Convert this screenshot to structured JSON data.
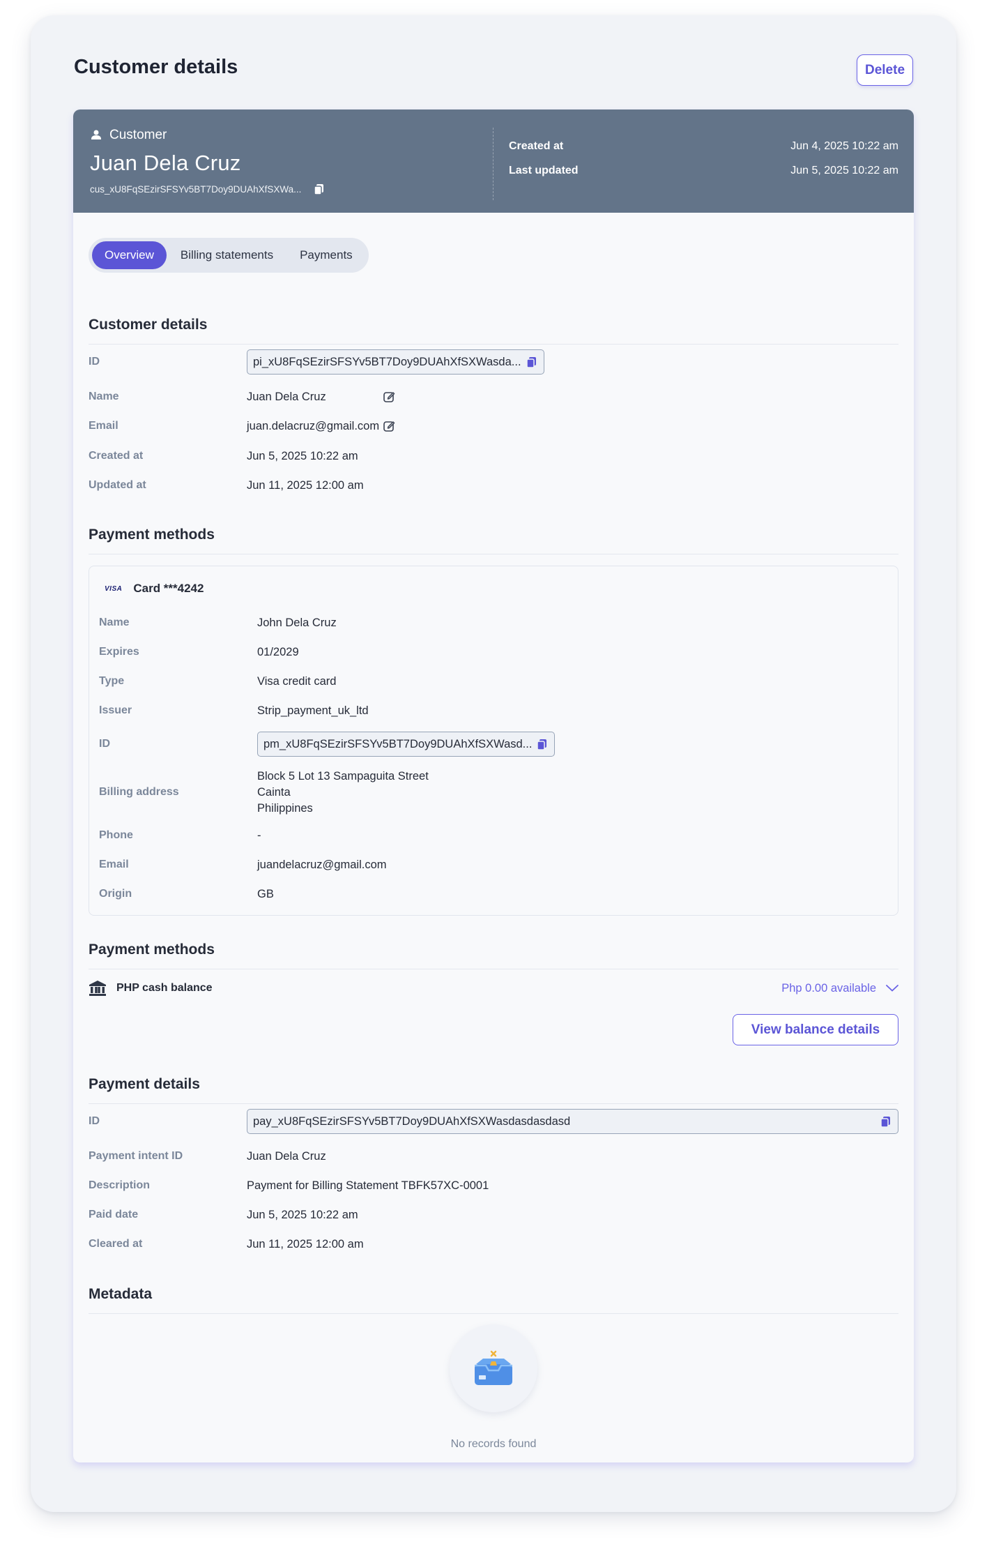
{
  "page": {
    "title": "Customer details",
    "delete_label": "Delete"
  },
  "hero": {
    "kind_label": "Customer",
    "name": "Juan Dela Cruz",
    "customer_id": "cus_xU8FqSEzirSFSYv5BT7Doy9DUAhXfSXWa...",
    "meta": [
      {
        "label": "Created at",
        "value": "Jun 4, 2025 10:22 am"
      },
      {
        "label": "Last updated",
        "value": "Jun 5, 2025 10:22 am"
      }
    ]
  },
  "tabs": [
    "Overview",
    "Billing statements",
    "Payments"
  ],
  "customer_details": {
    "title": "Customer details",
    "id_label": "ID",
    "id_value": "pi_xU8FqSEzirSFSYv5BT7Doy9DUAhXfSXWasda...",
    "name_label": "Name",
    "name_value": "Juan Dela Cruz",
    "email_label": "Email",
    "email_value": "juan.delacruz@gmail.com",
    "created_label": "Created at",
    "created_value": "Jun 5, 2025 10:22 am",
    "updated_label": "Updated at",
    "updated_value": "Jun 11, 2025 12:00 am"
  },
  "payment_methods": {
    "title": "Payment methods",
    "card_brand": "VISA",
    "card_label": "Card ***4242",
    "name_label": "Name",
    "name_value": "John Dela Cruz",
    "expires_label": "Expires",
    "expires_value": "01/2029",
    "type_label": "Type",
    "type_value": "Visa credit card",
    "issuer_label": "Issuer",
    "issuer_value": "Strip_payment_uk_ltd",
    "id_label": "ID",
    "id_value": "pm_xU8FqSEzirSFSYv5BT7Doy9DUAhXfSXWasd...",
    "address_label": "Billing address",
    "address_lines": [
      "Block 5 Lot 13 Sampaguita Street",
      "Cainta",
      "Philippines"
    ],
    "phone_label": "Phone",
    "phone_value": "-",
    "email_label": "Email",
    "email_value": "juandelacruz@gmail.com",
    "origin_label": "Origin",
    "origin_value": "GB"
  },
  "cash_balance": {
    "title": "Payment methods",
    "label": "PHP cash balance",
    "available": "Php 0.00 available",
    "button_label": "View balance details"
  },
  "payment_details": {
    "title": "Payment details",
    "id_label": "ID",
    "id_value": "pay_xU8FqSEzirSFSYv5BT7Doy9DUAhXfSXWasdasdasdasd",
    "intent_label": "Payment intent ID",
    "intent_value": "Juan Dela Cruz",
    "description_label": "Description",
    "description_value": "Payment for Billing Statement TBFK57XC-0001",
    "paid_label": "Paid date",
    "paid_value": "Jun 5, 2025 10:22 am",
    "cleared_label": "Cleared at",
    "cleared_value": "Jun 11, 2025 12:00 am"
  },
  "metadata": {
    "title": "Metadata",
    "empty_text": "No records found"
  },
  "colors": {
    "accent": "#5b55d6",
    "hero_bg": "#637489",
    "label": "#7b879a"
  }
}
